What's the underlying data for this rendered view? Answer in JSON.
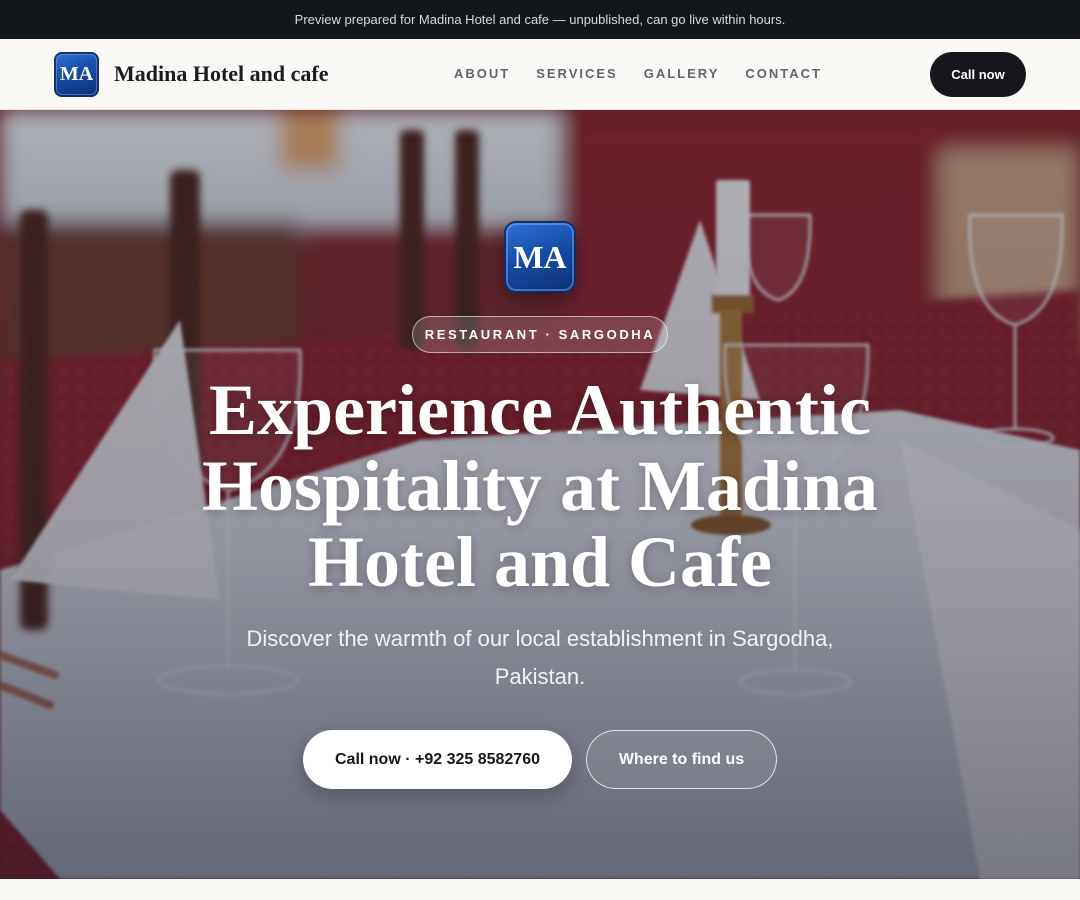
{
  "announcement": {
    "text": "Preview prepared for Madina Hotel and cafe — unpublished, can go live within hours."
  },
  "header": {
    "logo_initials": "MA",
    "brand_name": "Madina Hotel and cafe",
    "nav": [
      {
        "label": "ABOUT"
      },
      {
        "label": "SERVICES"
      },
      {
        "label": "GALLERY"
      },
      {
        "label": "CONTACT"
      }
    ],
    "cta_label": "Call now"
  },
  "hero": {
    "logo_initials": "MA",
    "tag": "RESTAURANT · SARGODHA",
    "title": "Experience Authentic Hospitality at Madina Hotel and Cafe",
    "subtitle": "Discover the warmth of our local establishment in Sargodha, Pakistan.",
    "primary_button": "Call now · +92 325 8582760",
    "secondary_button": "Where to find us",
    "background_image": "restaurant-table-setting"
  },
  "colors": {
    "topbar_bg": "#13161b",
    "brand_blue": "#174ea8",
    "cta_dark": "#15171c",
    "tablecloth_red": "#8a1e24"
  }
}
